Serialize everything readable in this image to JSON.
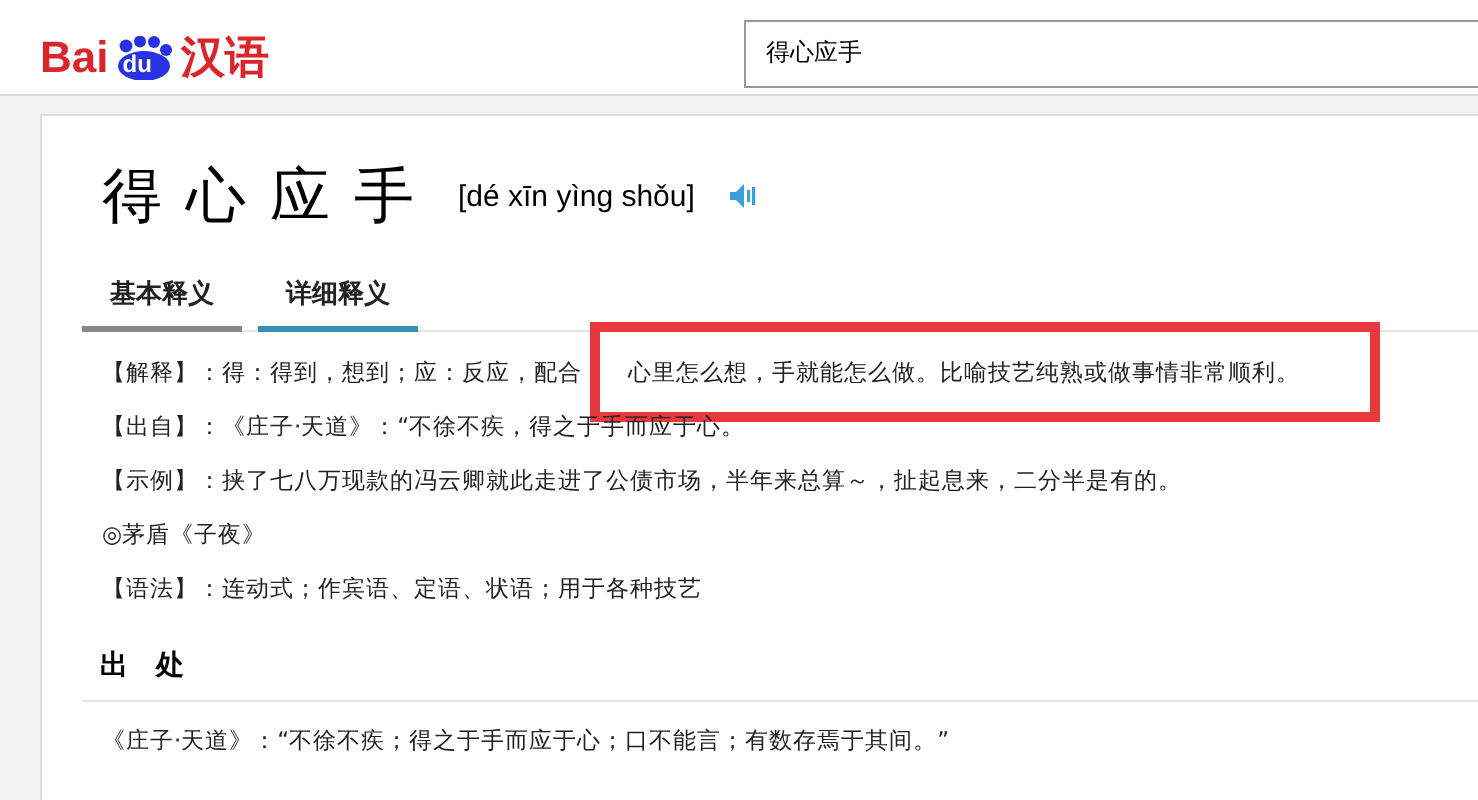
{
  "logo": {
    "brand": "Bai",
    "badge": "du",
    "product": "汉语"
  },
  "search": {
    "value": "得心应手"
  },
  "entry": {
    "headword": "得心应手",
    "pinyin": "[dé xīn yìng shǒu]"
  },
  "tabs": [
    {
      "label": "基本释义",
      "selected": false
    },
    {
      "label": "详细释义",
      "selected": true
    }
  ],
  "definition_lines": [
    {
      "text": "【解释】：得：得到，想到；应：反应，配合",
      "highlighted_text": "心里怎么想，手就能怎么做。比喻技艺纯熟或做事情非常顺利。"
    },
    {
      "text": "【出自】：《庄子·天道》：“不徐不疾，得之于手而应于心。"
    },
    {
      "text": "【示例】：挟了七八万现款的冯云卿就此走进了公债市场，半年来总算～，扯起息来，二分半是有的。"
    },
    {
      "text": "◎茅盾《子夜》"
    },
    {
      "text": "【语法】：连动式；作宾语、定语、状语；用于各种技艺"
    }
  ],
  "source_section": {
    "title": "出　处",
    "text": "《庄子·天道》：“不徐不疾；得之于手而应于心；口不能言；有数存焉于其间。”"
  },
  "highlight": {
    "kind": "box"
  }
}
